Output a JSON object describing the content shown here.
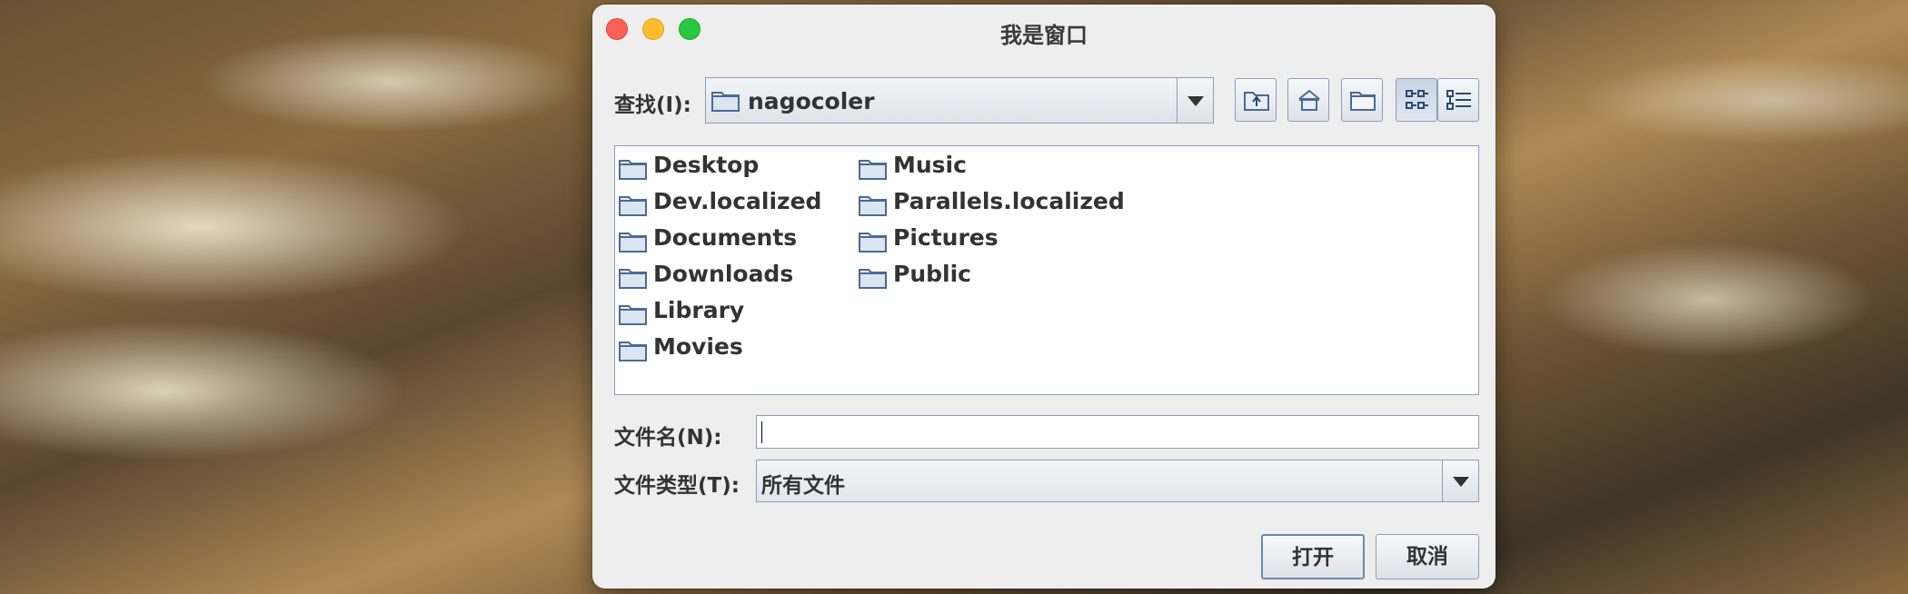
{
  "window": {
    "title": "我是窗口"
  },
  "look_in": {
    "label": "查找(I):",
    "value": "nagocoler"
  },
  "toolbar": {
    "up_folder": "up-one-level",
    "home": "home",
    "new_folder": "create-new-folder",
    "list_view": "list",
    "details_view": "details"
  },
  "files": {
    "column1": [
      "Desktop",
      "Dev.localized",
      "Documents",
      "Downloads",
      "Library",
      "Movies"
    ],
    "column2": [
      "Music",
      "Parallels.localized",
      "Pictures",
      "Public"
    ]
  },
  "file_name": {
    "label": "文件名(N):",
    "value": ""
  },
  "file_type": {
    "label": "文件类型(T):",
    "value": "所有文件"
  },
  "buttons": {
    "open": "打开",
    "cancel": "取消"
  },
  "colors": {
    "close": "#fe5f57",
    "minimize": "#febc2e",
    "maximize": "#28c840",
    "border": "#8c9eb8"
  }
}
